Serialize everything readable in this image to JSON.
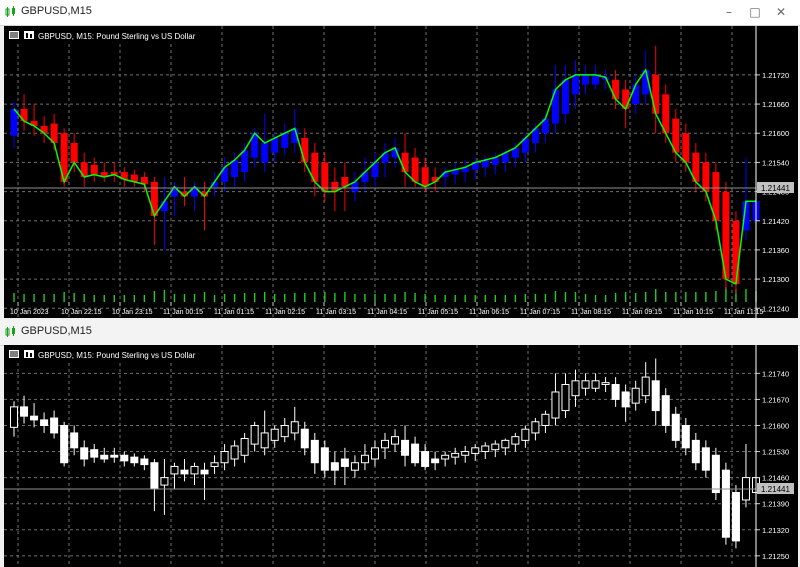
{
  "windows": [
    {
      "title": "GBPUSD,M15",
      "header": "GBPUSD, M15:  Pound Sterling vs US Dollar",
      "current_price": "1.21441",
      "chart_data": {
        "type": "candlestick",
        "symbol": "GBPUSD",
        "timeframe": "M15",
        "description": "Pound Sterling vs US Dollar",
        "ylim": [
          1.2122,
          1.218
        ],
        "y_ticks": [
          "1.21720",
          "1.21660",
          "1.21600",
          "1.21540",
          "1.21480",
          "1.21420",
          "1.21360",
          "1.21300",
          "1.21240"
        ],
        "x_ticks": [
          "10 Jan 2023",
          "10 Jan 22:15",
          "10 Jan 23:15",
          "11 Jan 00:15",
          "11 Jan 01:15",
          "11 Jan 02:15",
          "11 Jan 03:15",
          "11 Jan 04:15",
          "11 Jan 05:15",
          "11 Jan 06:15",
          "11 Jan 07:15",
          "11 Jan 08:15",
          "11 Jan 09:15",
          "11 Jan 10:15",
          "11 Jan 11:15"
        ],
        "candles": [
          {
            "o": 1.21595,
            "h": 1.21665,
            "l": 1.2157,
            "c": 1.2165
          },
          {
            "o": 1.2165,
            "h": 1.2168,
            "l": 1.21605,
            "c": 1.21625
          },
          {
            "o": 1.21625,
            "h": 1.2166,
            "l": 1.21595,
            "c": 1.21615
          },
          {
            "o": 1.21615,
            "h": 1.21635,
            "l": 1.2158,
            "c": 1.216
          },
          {
            "o": 1.2162,
            "h": 1.2164,
            "l": 1.21565,
            "c": 1.2158
          },
          {
            "o": 1.216,
            "h": 1.2161,
            "l": 1.2149,
            "c": 1.215
          },
          {
            "o": 1.2158,
            "h": 1.216,
            "l": 1.2152,
            "c": 1.2154
          },
          {
            "o": 1.2154,
            "h": 1.2156,
            "l": 1.2149,
            "c": 1.2151
          },
          {
            "o": 1.21535,
            "h": 1.2155,
            "l": 1.215,
            "c": 1.21515
          },
          {
            "o": 1.2152,
            "h": 1.2154,
            "l": 1.215,
            "c": 1.2151
          },
          {
            "o": 1.2152,
            "h": 1.2154,
            "l": 1.215,
            "c": 1.21515
          },
          {
            "o": 1.2152,
            "h": 1.2153,
            "l": 1.2149,
            "c": 1.21505
          },
          {
            "o": 1.21515,
            "h": 1.21525,
            "l": 1.2149,
            "c": 1.215
          },
          {
            "o": 1.2151,
            "h": 1.2152,
            "l": 1.2148,
            "c": 1.21495
          },
          {
            "o": 1.215,
            "h": 1.2151,
            "l": 1.2137,
            "c": 1.2143
          },
          {
            "o": 1.2144,
            "h": 1.2151,
            "l": 1.2136,
            "c": 1.2146
          },
          {
            "o": 1.2147,
            "h": 1.215,
            "l": 1.2143,
            "c": 1.2149
          },
          {
            "o": 1.2148,
            "h": 1.2151,
            "l": 1.2145,
            "c": 1.2147
          },
          {
            "o": 1.2147,
            "h": 1.215,
            "l": 1.2144,
            "c": 1.2149
          },
          {
            "o": 1.2148,
            "h": 1.215,
            "l": 1.214,
            "c": 1.2147
          },
          {
            "o": 1.2149,
            "h": 1.2152,
            "l": 1.2147,
            "c": 1.215
          },
          {
            "o": 1.215,
            "h": 1.2155,
            "l": 1.2148,
            "c": 1.2153
          },
          {
            "o": 1.2151,
            "h": 1.2156,
            "l": 1.2149,
            "c": 1.21545
          },
          {
            "o": 1.2152,
            "h": 1.2158,
            "l": 1.215,
            "c": 1.21565
          },
          {
            "o": 1.2155,
            "h": 1.2161,
            "l": 1.2153,
            "c": 1.216
          },
          {
            "o": 1.2154,
            "h": 1.2164,
            "l": 1.2152,
            "c": 1.2158
          },
          {
            "o": 1.2156,
            "h": 1.216,
            "l": 1.2154,
            "c": 1.2159
          },
          {
            "o": 1.2157,
            "h": 1.2162,
            "l": 1.21555,
            "c": 1.216
          },
          {
            "o": 1.2158,
            "h": 1.2165,
            "l": 1.2156,
            "c": 1.2161
          },
          {
            "o": 1.2159,
            "h": 1.2161,
            "l": 1.2152,
            "c": 1.2154
          },
          {
            "o": 1.2156,
            "h": 1.2158,
            "l": 1.2147,
            "c": 1.215
          },
          {
            "o": 1.2154,
            "h": 1.2156,
            "l": 1.2146,
            "c": 1.2148
          },
          {
            "o": 1.215,
            "h": 1.2153,
            "l": 1.2144,
            "c": 1.2148
          },
          {
            "o": 1.2151,
            "h": 1.2154,
            "l": 1.2144,
            "c": 1.2149
          },
          {
            "o": 1.2148,
            "h": 1.2152,
            "l": 1.2146,
            "c": 1.215
          },
          {
            "o": 1.215,
            "h": 1.2155,
            "l": 1.2148,
            "c": 1.2152
          },
          {
            "o": 1.2151,
            "h": 1.2156,
            "l": 1.2149,
            "c": 1.2154
          },
          {
            "o": 1.2154,
            "h": 1.2158,
            "l": 1.2151,
            "c": 1.2156
          },
          {
            "o": 1.2155,
            "h": 1.2159,
            "l": 1.2153,
            "c": 1.2157
          },
          {
            "o": 1.2156,
            "h": 1.216,
            "l": 1.2149,
            "c": 1.2152
          },
          {
            "o": 1.2155,
            "h": 1.2157,
            "l": 1.2149,
            "c": 1.215
          },
          {
            "o": 1.2153,
            "h": 1.2155,
            "l": 1.2148,
            "c": 1.2149
          },
          {
            "o": 1.2151,
            "h": 1.2153,
            "l": 1.2148,
            "c": 1.215
          },
          {
            "o": 1.2151,
            "h": 1.2153,
            "l": 1.2149,
            "c": 1.2152
          },
          {
            "o": 1.21515,
            "h": 1.2154,
            "l": 1.21495,
            "c": 1.21525
          },
          {
            "o": 1.2152,
            "h": 1.21545,
            "l": 1.215,
            "c": 1.2153
          },
          {
            "o": 1.21525,
            "h": 1.2155,
            "l": 1.21505,
            "c": 1.2154
          },
          {
            "o": 1.2153,
            "h": 1.21555,
            "l": 1.2151,
            "c": 1.21545
          },
          {
            "o": 1.21535,
            "h": 1.2156,
            "l": 1.21515,
            "c": 1.2155
          },
          {
            "o": 1.2154,
            "h": 1.21565,
            "l": 1.2152,
            "c": 1.2156
          },
          {
            "o": 1.2155,
            "h": 1.2158,
            "l": 1.2153,
            "c": 1.2157
          },
          {
            "o": 1.2156,
            "h": 1.216,
            "l": 1.2154,
            "c": 1.2159
          },
          {
            "o": 1.2158,
            "h": 1.2162,
            "l": 1.2156,
            "c": 1.2161
          },
          {
            "o": 1.216,
            "h": 1.2164,
            "l": 1.2158,
            "c": 1.2163
          },
          {
            "o": 1.2162,
            "h": 1.2174,
            "l": 1.216,
            "c": 1.2169
          },
          {
            "o": 1.2164,
            "h": 1.2174,
            "l": 1.2162,
            "c": 1.2171
          },
          {
            "o": 1.2168,
            "h": 1.2175,
            "l": 1.2165,
            "c": 1.2172
          },
          {
            "o": 1.217,
            "h": 1.2174,
            "l": 1.2168,
            "c": 1.2172
          },
          {
            "o": 1.217,
            "h": 1.2174,
            "l": 1.2169,
            "c": 1.2172
          },
          {
            "o": 1.2171,
            "h": 1.2173,
            "l": 1.2169,
            "c": 1.21715
          },
          {
            "o": 1.2171,
            "h": 1.2173,
            "l": 1.2165,
            "c": 1.2167
          },
          {
            "o": 1.2169,
            "h": 1.2171,
            "l": 1.2161,
            "c": 1.2165
          },
          {
            "o": 1.2166,
            "h": 1.2172,
            "l": 1.2164,
            "c": 1.217
          },
          {
            "o": 1.2168,
            "h": 1.2177,
            "l": 1.2166,
            "c": 1.2173
          },
          {
            "o": 1.2172,
            "h": 1.2178,
            "l": 1.216,
            "c": 1.2164
          },
          {
            "o": 1.2168,
            "h": 1.217,
            "l": 1.2158,
            "c": 1.216
          },
          {
            "o": 1.2163,
            "h": 1.2165,
            "l": 1.2154,
            "c": 1.2156
          },
          {
            "o": 1.216,
            "h": 1.2162,
            "l": 1.2152,
            "c": 1.2154
          },
          {
            "o": 1.2156,
            "h": 1.2158,
            "l": 1.2148,
            "c": 1.215
          },
          {
            "o": 1.2154,
            "h": 1.2156,
            "l": 1.2146,
            "c": 1.2148
          },
          {
            "o": 1.2152,
            "h": 1.2154,
            "l": 1.214,
            "c": 1.2142
          },
          {
            "o": 1.2148,
            "h": 1.215,
            "l": 1.2128,
            "c": 1.213
          },
          {
            "o": 1.2142,
            "h": 1.2144,
            "l": 1.2127,
            "c": 1.2129
          },
          {
            "o": 1.214,
            "h": 1.2155,
            "l": 1.2138,
            "c": 1.2146
          },
          {
            "o": 1.2142,
            "h": 1.2154,
            "l": 1.214,
            "c": 1.2146
          }
        ],
        "line_ma": true,
        "volume": true,
        "grid": true
      }
    },
    {
      "title": "GBPUSD,M15",
      "header": "GBPUSD, M15:  Pound Sterling vs US Dollar",
      "current_price": "1.21441",
      "chart_data": {
        "type": "candlestick",
        "symbol": "GBPUSD",
        "timeframe": "M15",
        "description": "Pound Sterling vs US Dollar",
        "ylim": [
          1.2122,
          1.218
        ],
        "y_ticks": [
          "1.21740",
          "1.21670",
          "1.21600",
          "1.21530",
          "1.21460",
          "1.21390",
          "1.21320",
          "1.21250"
        ],
        "grid": true
      }
    }
  ],
  "icons": {
    "app": "mt-chart-icon",
    "minimize": "minimize-icon",
    "maximize": "maximize-icon",
    "close": "close-icon"
  },
  "colors": {
    "bull": "#0000ff",
    "bear": "#ff0000",
    "bull_outline": "#ffffff",
    "line": "#00ff00",
    "grid": "#6f6f6f",
    "volume": "#22cc22"
  }
}
